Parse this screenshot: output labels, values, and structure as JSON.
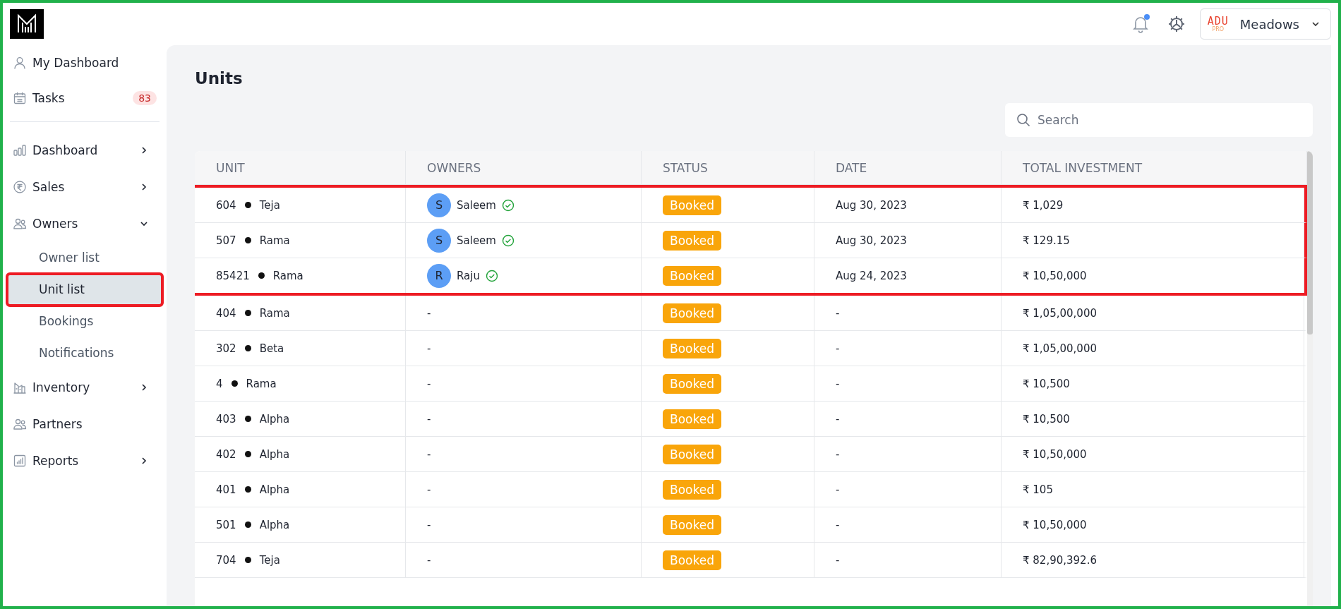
{
  "header": {
    "notification_unread": true,
    "project": {
      "logo_text": "ADU",
      "logo_subtext": "PRO",
      "name": "Meadows"
    }
  },
  "sidebar": {
    "top_items": [
      {
        "label": "My Dashboard"
      },
      {
        "label": "Tasks",
        "badge": "83"
      }
    ],
    "items": [
      {
        "label": "Dashboard",
        "expanded": false
      },
      {
        "label": "Sales",
        "expanded": false
      },
      {
        "label": "Owners",
        "expanded": true,
        "children": [
          {
            "label": "Owner list",
            "selected": false,
            "highlighted": false
          },
          {
            "label": "Unit list",
            "selected": true,
            "highlighted": true
          },
          {
            "label": "Bookings",
            "selected": false,
            "highlighted": false
          },
          {
            "label": "Notifications",
            "selected": false,
            "highlighted": false
          }
        ]
      },
      {
        "label": "Inventory",
        "expanded": false
      },
      {
        "label": "Partners"
      },
      {
        "label": "Reports",
        "expanded": false
      }
    ]
  },
  "page": {
    "title": "Units",
    "search": {
      "placeholder": "Search"
    }
  },
  "table": {
    "columns": [
      "UNIT",
      "OWNERS",
      "STATUS",
      "DATE",
      "TOTAL INVESTMENT"
    ],
    "rows": [
      {
        "unit": "604",
        "tower": "Teja",
        "owner": {
          "initial": "S",
          "name": "Saleem",
          "verified": true
        },
        "status": "Booked",
        "date": "Aug 30, 2023",
        "total": "₹ 1,029",
        "highlighted": true
      },
      {
        "unit": "507",
        "tower": "Rama",
        "owner": {
          "initial": "S",
          "name": "Saleem",
          "verified": true
        },
        "status": "Booked",
        "date": "Aug 30, 2023",
        "total": "₹ 129.15",
        "highlighted": true
      },
      {
        "unit": "85421",
        "tower": "Rama",
        "owner": {
          "initial": "R",
          "name": "Raju",
          "verified": true
        },
        "status": "Booked",
        "date": "Aug 24, 2023",
        "total": "₹ 10,50,000",
        "highlighted": true
      },
      {
        "unit": "404",
        "tower": "Rama",
        "owner_text": "-",
        "status": "Booked",
        "date": "-",
        "total": "₹ 1,05,00,000",
        "highlighted": false
      },
      {
        "unit": "302",
        "tower": "Beta",
        "owner_text": "-",
        "status": "Booked",
        "date": "-",
        "total": "₹ 1,05,00,000",
        "highlighted": false
      },
      {
        "unit": "4",
        "tower": "Rama",
        "owner_text": "-",
        "status": "Booked",
        "date": "-",
        "total": "₹ 10,500",
        "highlighted": false
      },
      {
        "unit": "403",
        "tower": "Alpha",
        "owner_text": "-",
        "status": "Booked",
        "date": "-",
        "total": "₹ 10,500",
        "highlighted": false
      },
      {
        "unit": "402",
        "tower": "Alpha",
        "owner_text": "-",
        "status": "Booked",
        "date": "-",
        "total": "₹ 10,50,000",
        "highlighted": false
      },
      {
        "unit": "401",
        "tower": "Alpha",
        "owner_text": "-",
        "status": "Booked",
        "date": "-",
        "total": "₹ 105",
        "highlighted": false
      },
      {
        "unit": "501",
        "tower": "Alpha",
        "owner_text": "-",
        "status": "Booked",
        "date": "-",
        "total": "₹ 10,50,000",
        "highlighted": false
      },
      {
        "unit": "704",
        "tower": "Teja",
        "owner_text": "-",
        "status": "Booked",
        "date": "-",
        "total": "₹ 82,90,392.6",
        "highlighted": false
      }
    ]
  }
}
